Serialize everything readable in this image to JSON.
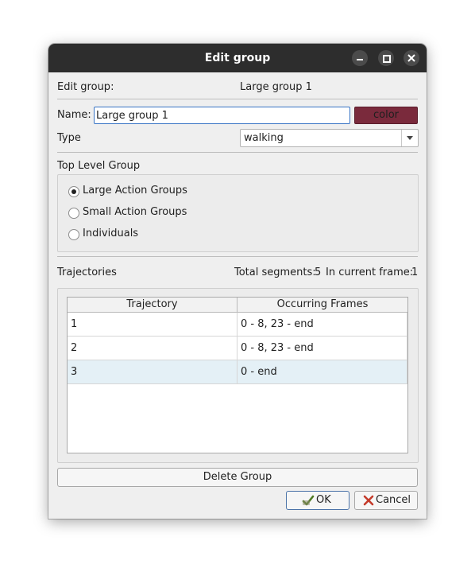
{
  "window": {
    "title": "Edit group"
  },
  "header": {
    "edit_group_label": "Edit group:",
    "edit_group_value": "Large group 1"
  },
  "name_row": {
    "label": "Name:",
    "value": "Large group 1",
    "color_button": "color",
    "color_swatch": "#7a2a3c"
  },
  "type_row": {
    "label": "Type",
    "selected": "walking"
  },
  "top_level": {
    "title": "Top Level Group",
    "options": [
      {
        "label": "Large Action Groups",
        "checked": true
      },
      {
        "label": "Small Action Groups",
        "checked": false
      },
      {
        "label": "Individuals",
        "checked": false
      }
    ]
  },
  "trajectories": {
    "title": "Trajectories",
    "total_segments_label": "Total segments:",
    "total_segments_value": "5",
    "current_frame_label": "In current frame:",
    "current_frame_value": "1",
    "columns": [
      "Trajectory",
      "Occurring Frames"
    ],
    "rows": [
      {
        "trajectory": "1",
        "frames": "0 - 8, 23 - end",
        "selected": false
      },
      {
        "trajectory": "2",
        "frames": "0 - 8, 23 - end",
        "selected": false
      },
      {
        "trajectory": "3",
        "frames": "0 - end",
        "selected": true
      }
    ]
  },
  "buttons": {
    "delete": "Delete Group",
    "ok": "OK",
    "cancel": "Cancel"
  },
  "colors": {
    "titlebar": "#2d2d2d",
    "selection": "#e4f0f6",
    "focus": "#3874c4"
  }
}
